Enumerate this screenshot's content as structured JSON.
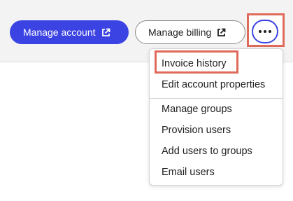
{
  "toolbar": {
    "manage_account_label": "Manage account",
    "manage_billing_label": "Manage billing",
    "external_link_icon": "external-link-icon",
    "more_icon": "ellipsis-icon"
  },
  "menu": {
    "items": [
      {
        "label": "Invoice history",
        "highlighted": true
      },
      {
        "label": "Edit account properties"
      },
      {
        "label": "Manage groups"
      },
      {
        "label": "Provision users"
      },
      {
        "label": "Add users to groups"
      },
      {
        "label": "Email users"
      }
    ]
  },
  "colors": {
    "primary": "#3b43e3",
    "highlight": "#e06a59"
  }
}
